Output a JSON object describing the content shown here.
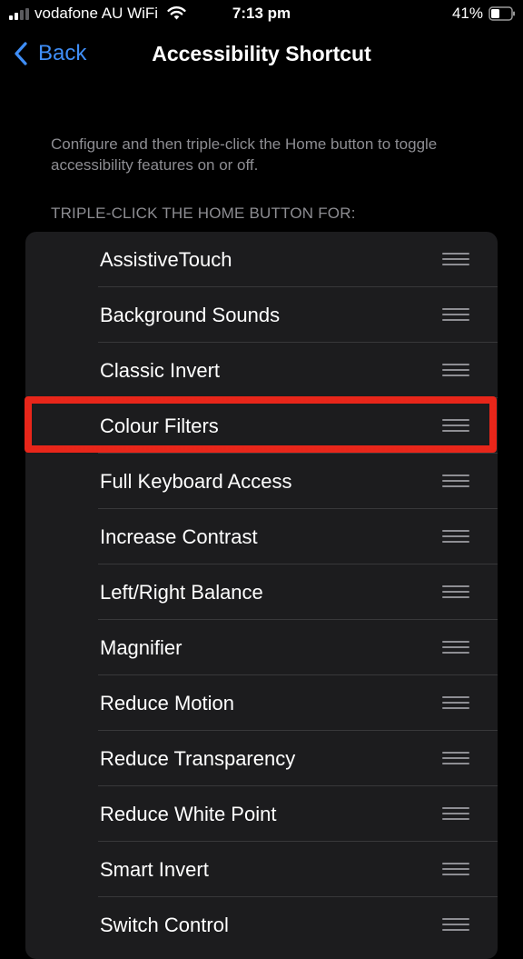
{
  "status_bar": {
    "carrier": "vodafone AU WiFi",
    "time": "7:13 pm",
    "battery_percent": "41%",
    "icons": [
      "signal-icon",
      "wifi-icon",
      "battery-icon"
    ]
  },
  "nav": {
    "back_label": "Back",
    "title": "Accessibility Shortcut",
    "accent_color": "#3f8ef7"
  },
  "description": "Configure and then triple-click the Home button to toggle accessibility features on or off.",
  "section_header": "TRIPLE-CLICK THE HOME BUTTON FOR:",
  "items": [
    {
      "label": "AssistiveTouch"
    },
    {
      "label": "Background Sounds"
    },
    {
      "label": "Classic Invert"
    },
    {
      "label": "Colour Filters",
      "highlighted": true
    },
    {
      "label": "Full Keyboard Access"
    },
    {
      "label": "Increase Contrast"
    },
    {
      "label": "Left/Right Balance"
    },
    {
      "label": "Magnifier"
    },
    {
      "label": "Reduce Motion"
    },
    {
      "label": "Reduce Transparency"
    },
    {
      "label": "Reduce White Point"
    },
    {
      "label": "Smart Invert"
    },
    {
      "label": "Switch Control"
    }
  ],
  "colors": {
    "background": "#000000",
    "list_background": "#1c1c1e",
    "secondary_text": "#8d8d92",
    "highlight": "#e8261a"
  }
}
